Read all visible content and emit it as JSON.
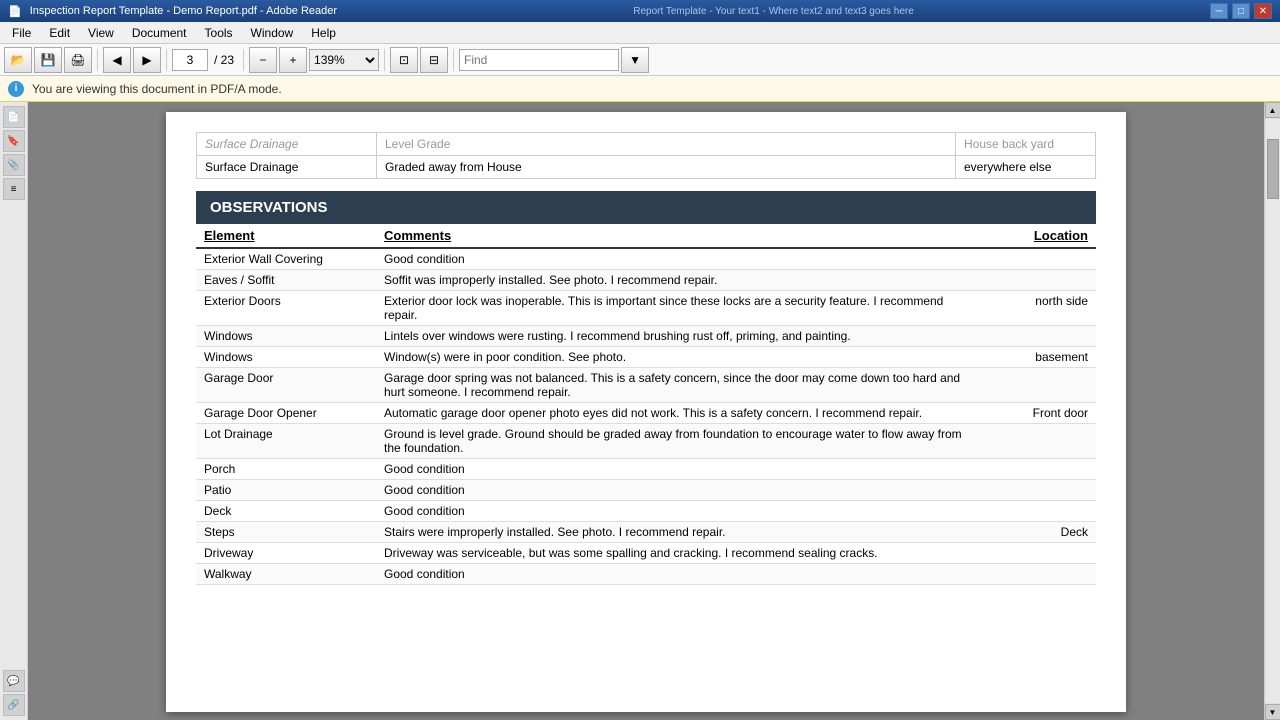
{
  "titleBar": {
    "title": "Inspection Report Template - Demo Report.pdf - Adobe Reader",
    "watermark": "Report Template - Your text1 - Where text2 and text3 goes here",
    "minimizeLabel": "─",
    "maximizeLabel": "□",
    "closeLabel": "✕"
  },
  "menuBar": {
    "items": [
      "File",
      "Edit",
      "View",
      "Document",
      "Tools",
      "Window",
      "Help"
    ]
  },
  "toolbar": {
    "pageValue": "3",
    "pageTotal": "/ 23",
    "zoomValue": "139%",
    "findPlaceholder": "Find"
  },
  "infoBar": {
    "message": "You are viewing this document in PDF/A mode."
  },
  "topTable": {
    "rows": [
      {
        "element": "Surface Drainage",
        "comment": "Level Grade",
        "location": "House back yard"
      },
      {
        "element": "Surface Drainage",
        "comment": "Graded away from House",
        "location": "everywhere else"
      }
    ]
  },
  "observations": {
    "header": "OBSERVATIONS",
    "columns": {
      "element": "Element",
      "comments": "Comments",
      "location": "Location"
    },
    "rows": [
      {
        "element": "Exterior Wall Covering",
        "comments": "Good condition",
        "location": ""
      },
      {
        "element": "Eaves / Soffit",
        "comments": "Soffit was improperly installed. See photo. I recommend repair.",
        "location": ""
      },
      {
        "element": "Exterior Doors",
        "comments": "Exterior door lock was inoperable. This is important since these locks are a security feature. I recommend repair.",
        "location": "north side"
      },
      {
        "element": "Windows",
        "comments": "Lintels over windows were rusting.  I recommend brushing rust off, priming, and painting.",
        "location": ""
      },
      {
        "element": "Windows",
        "comments": "Window(s) were in poor condition.  See photo.",
        "location": "basement"
      },
      {
        "element": "Garage Door",
        "comments": "Garage door spring was not balanced.  This is a safety concern, since the door may come down too hard and hurt someone. I recommend repair.",
        "location": ""
      },
      {
        "element": "Garage Door Opener",
        "comments": "Automatic garage door opener photo eyes did not work.  This is a safety concern.  I recommend repair.",
        "location": "Front door"
      },
      {
        "element": "Lot Drainage",
        "comments": "Ground is level grade.  Ground should be graded away from foundation to encourage water to flow away from the foundation.",
        "location": ""
      },
      {
        "element": "Porch",
        "comments": "Good condition",
        "location": ""
      },
      {
        "element": "Patio",
        "comments": "Good condition",
        "location": ""
      },
      {
        "element": "Deck",
        "comments": "Good condition",
        "location": ""
      },
      {
        "element": "Steps",
        "comments": "Stairs were improperly installed.  See photo. I recommend repair.",
        "location": "Deck"
      },
      {
        "element": "Driveway",
        "comments": "Driveway was serviceable, but was some spalling and cracking.  I recommend sealing cracks.",
        "location": ""
      },
      {
        "element": "Walkway",
        "comments": "Good condition",
        "location": ""
      }
    ]
  }
}
